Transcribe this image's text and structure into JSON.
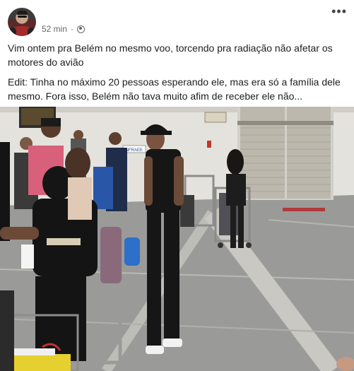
{
  "post": {
    "timestamp": "52 min",
    "separator": "·",
    "privacy_icon": "globe-icon",
    "more_icon": "more-options-icon",
    "paragraph1": "Vim ontem pra Belém no mesmo voo, torcendo pra radiação não afetar os motores do avião",
    "paragraph2": "Edit: Tinha no máximo 20 pessoas esperando ele, mas era só a família dele mesmo. Fora isso, Belém não tava muito afim de receber ele não...",
    "photo": {
      "sign_text": "INFRAEE"
    }
  }
}
